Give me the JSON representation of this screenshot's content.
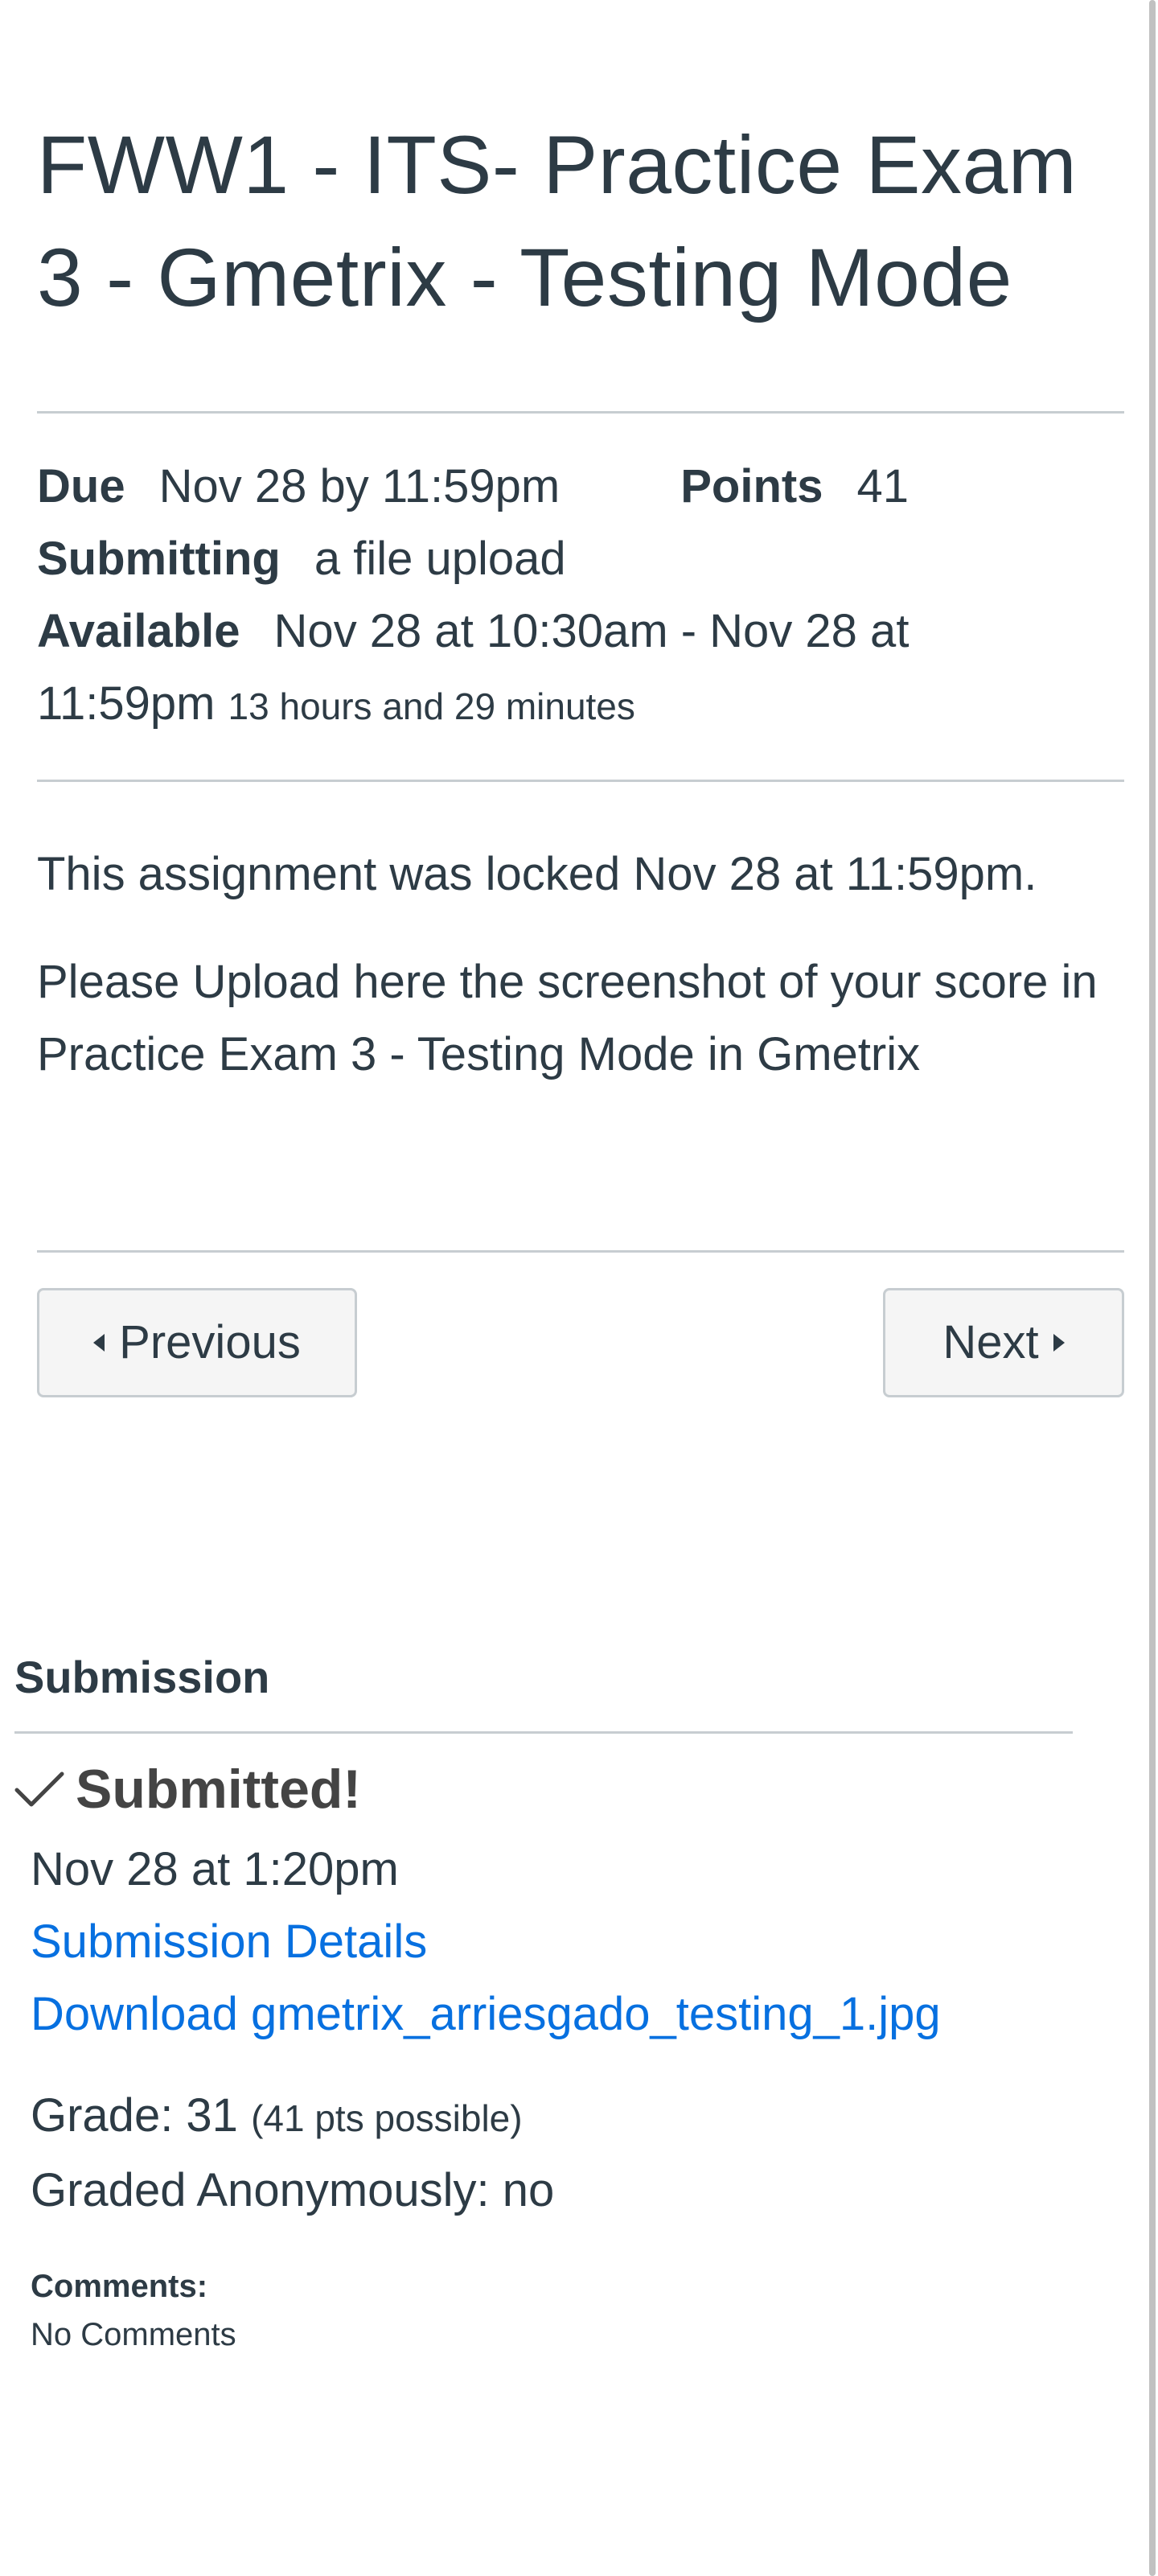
{
  "assignment": {
    "title": "FWW1 - ITS- Practice Exam 3 - Gmetrix - Testing Mode",
    "due_label": "Due",
    "due_value": "Nov 28 by 11:59pm",
    "points_label": "Points",
    "points_value": "41",
    "submitting_label": "Submitting",
    "submitting_value": "a file upload",
    "available_label": "Available",
    "available_value_1": "Nov 28 at 10:30am - Nov 28 at",
    "available_value_2": "11:59pm",
    "available_duration": "13 hours and 29 minutes"
  },
  "description": {
    "lock_notice": "This assignment was locked Nov 28 at 11:59pm.",
    "instruction": "Please Upload here the screenshot of your score in Practice Exam 3 -  Testing Mode in Gmetrix"
  },
  "nav": {
    "previous_label": "Previous",
    "next_label": "Next"
  },
  "submission": {
    "heading": "Submission",
    "status": "Submitted!",
    "date": "Nov 28 at 1:20pm",
    "details_link": "Submission Details",
    "download_link": "Download gmetrix_arriesgado_testing_1.jpg",
    "grade_text": "Grade: 31",
    "grade_possible": "(41 pts possible)",
    "anonymous_text": "Graded Anonymously: no",
    "comments_label": "Comments:",
    "comments_value": "No Comments"
  },
  "icons": {
    "check": "check-icon",
    "previous": "caret-left-icon",
    "next": "caret-right-icon"
  },
  "colors": {
    "text": "#2d3b45",
    "link": "#0770e0",
    "divider": "#c7cdd1",
    "button_bg": "#f5f5f5"
  }
}
